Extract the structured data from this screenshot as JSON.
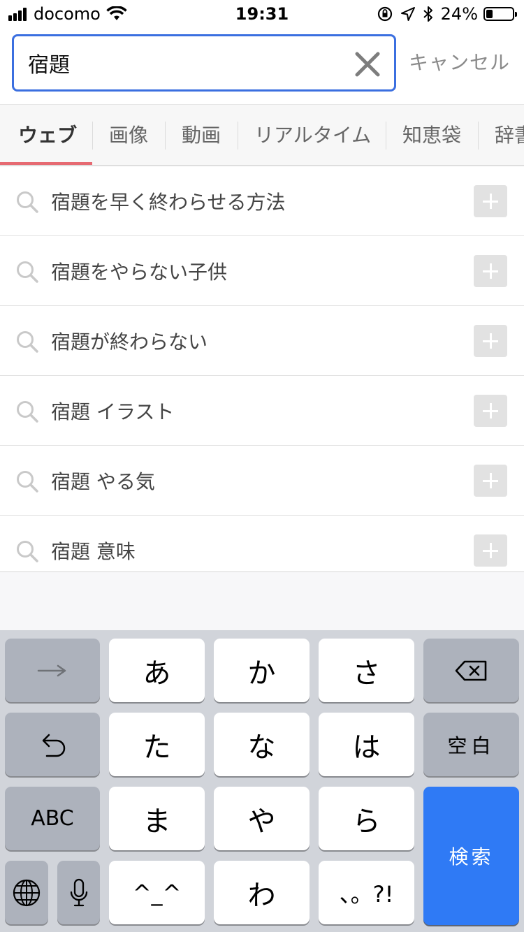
{
  "status_bar": {
    "carrier": "docomo",
    "time": "19:31",
    "battery_percent": "24%",
    "battery_level": 0.24,
    "icons": [
      "signal-icon",
      "wifi-icon",
      "orientation-lock-icon",
      "location-icon",
      "bluetooth-icon",
      "battery-icon"
    ]
  },
  "search": {
    "query": "宿題",
    "cancel_label": "キャンセル"
  },
  "tabs": [
    {
      "label": "ウェブ",
      "active": true
    },
    {
      "label": "画像",
      "active": false
    },
    {
      "label": "動画",
      "active": false
    },
    {
      "label": "リアルタイム",
      "active": false
    },
    {
      "label": "知恵袋",
      "active": false
    },
    {
      "label": "辞書",
      "active": false
    }
  ],
  "suggestions": [
    "宿題を早く終わらせる方法",
    "宿題をやらない子供",
    "宿題が終わらない",
    "宿題 イラスト",
    "宿題 やる気",
    "宿題 意味"
  ],
  "keyboard": {
    "row1": [
      "→",
      "あ",
      "か",
      "さ",
      "delete"
    ],
    "row2": [
      "undo",
      "た",
      "な",
      "は",
      "空白"
    ],
    "row3": [
      "ABC",
      "ま",
      "や",
      "ら"
    ],
    "row4": [
      "globe",
      "mic",
      "^_^",
      "わ",
      "、。?!"
    ],
    "return_label": "検索",
    "accent_color": "#2f7af5"
  },
  "colors": {
    "search_border": "#3b6fe0",
    "tab_underline": "#e66a72"
  }
}
